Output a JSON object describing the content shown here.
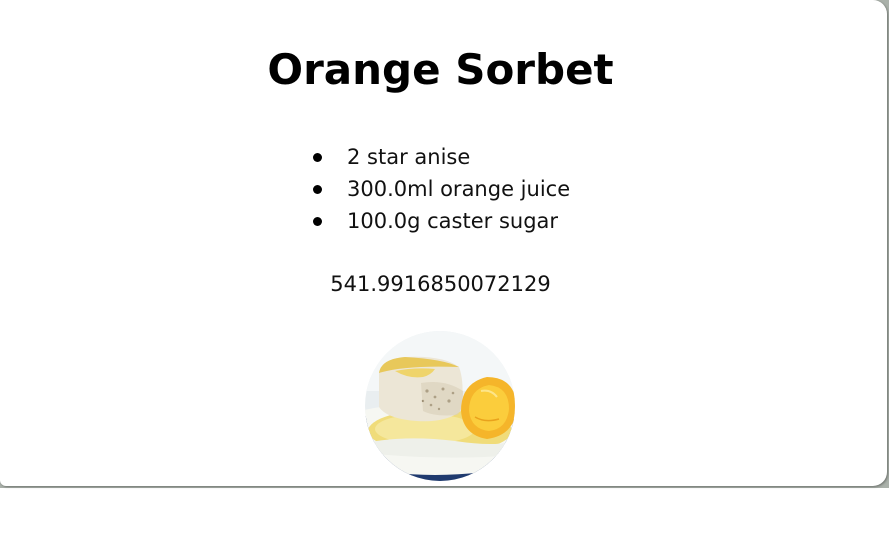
{
  "recipe": {
    "title": "Orange Sorbet",
    "ingredients": [
      "2 star anise",
      "300.0ml orange juice",
      "100.0g caster sugar"
    ],
    "calories": "541.9916850072129",
    "image_alt": "Orange Sorbet"
  },
  "colors": {
    "title_text": "#000000",
    "backdrop": "#aab1aa",
    "card": "#ffffff"
  }
}
